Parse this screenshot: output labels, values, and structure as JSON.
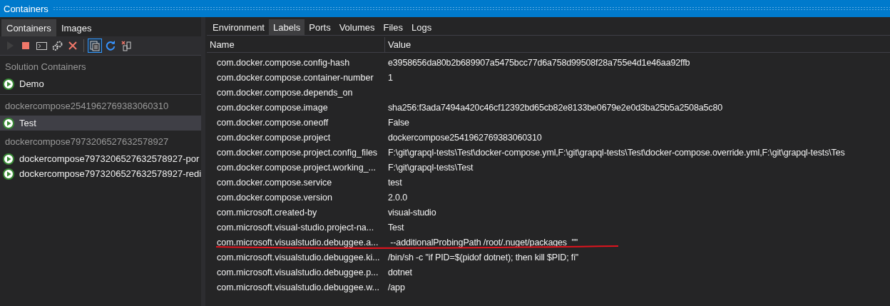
{
  "window": {
    "title": "Containers"
  },
  "left_tabs": [
    {
      "label": "Containers",
      "selected": true
    },
    {
      "label": "Images",
      "selected": false
    }
  ],
  "toolbar": [
    {
      "kind": "play",
      "disabled": true,
      "selected": false
    },
    {
      "kind": "stop",
      "disabled": false,
      "selected": false
    },
    {
      "kind": "terminal",
      "disabled": false,
      "selected": false
    },
    {
      "kind": "gears",
      "disabled": false,
      "selected": false
    },
    {
      "kind": "delete",
      "disabled": false,
      "selected": false
    },
    {
      "kind": "separator"
    },
    {
      "kind": "files",
      "disabled": false,
      "selected": true
    },
    {
      "kind": "refresh",
      "disabled": false,
      "selected": false
    },
    {
      "kind": "prune",
      "disabled": false,
      "selected": false
    }
  ],
  "groups": [
    {
      "title": "Solution Containers",
      "items": [
        {
          "name": "Demo",
          "selected": false
        }
      ]
    },
    {
      "title": "dockercompose2541962769383060310",
      "items": [
        {
          "name": "Test",
          "selected": true
        }
      ]
    },
    {
      "title": "dockercompose7973206527632578927",
      "items": [
        {
          "name": "dockercompose7973206527632578927-por",
          "selected": false
        },
        {
          "name": "dockercompose7973206527632578927-redi",
          "selected": false
        }
      ]
    }
  ],
  "detail_tabs": [
    {
      "label": "Environment",
      "selected": false
    },
    {
      "label": "Labels",
      "selected": true
    },
    {
      "label": "Ports",
      "selected": false
    },
    {
      "label": "Volumes",
      "selected": false
    },
    {
      "label": "Files",
      "selected": false
    },
    {
      "label": "Logs",
      "selected": false
    }
  ],
  "table": {
    "columns": [
      "Name",
      "Value"
    ],
    "rows": [
      {
        "name": "com.docker.compose.config-hash",
        "value": "e3958656da80b2b689907a5475bcc77d6a758d99508f28a755e4d1e46aa92ffb",
        "underlined": false
      },
      {
        "name": "com.docker.compose.container-number",
        "value": "1",
        "underlined": false
      },
      {
        "name": "com.docker.compose.depends_on",
        "value": "",
        "underlined": false
      },
      {
        "name": "com.docker.compose.image",
        "value": "sha256:f3ada7494a420c46cf12392bd65cb82e8133be0679e2e0d3ba25b5a2508a5c80",
        "underlined": false
      },
      {
        "name": "com.docker.compose.oneoff",
        "value": "False",
        "underlined": false
      },
      {
        "name": "com.docker.compose.project",
        "value": "dockercompose2541962769383060310",
        "underlined": false
      },
      {
        "name": "com.docker.compose.project.config_files",
        "value": "F:\\git\\grapql-tests\\Test\\docker-compose.yml,F:\\git\\grapql-tests\\Test\\docker-compose.override.yml,F:\\git\\grapql-tests\\Tes",
        "underlined": false
      },
      {
        "name": "com.docker.compose.project.working_...",
        "value": "F:\\git\\grapql-tests\\Test",
        "underlined": false
      },
      {
        "name": "com.docker.compose.service",
        "value": "test",
        "underlined": false
      },
      {
        "name": "com.docker.compose.version",
        "value": "2.0.0",
        "underlined": false
      },
      {
        "name": "com.microsoft.created-by",
        "value": "visual-studio",
        "underlined": false
      },
      {
        "name": "com.microsoft.visual-studio.project-na...",
        "value": "Test",
        "underlined": false
      },
      {
        "name": "com.microsoft.visualstudio.debuggee.a...",
        "value": " --additionalProbingPath /root/.nuget/packages  \"\"",
        "underlined": true
      },
      {
        "name": "com.microsoft.visualstudio.debuggee.ki...",
        "value": "/bin/sh -c \"if PID=$(pidof dotnet); then kill $PID; fi\"",
        "underlined": false
      },
      {
        "name": "com.microsoft.visualstudio.debuggee.p...",
        "value": "dotnet",
        "underlined": false
      },
      {
        "name": "com.microsoft.visualstudio.debuggee.w...",
        "value": "/app",
        "underlined": false
      }
    ]
  }
}
